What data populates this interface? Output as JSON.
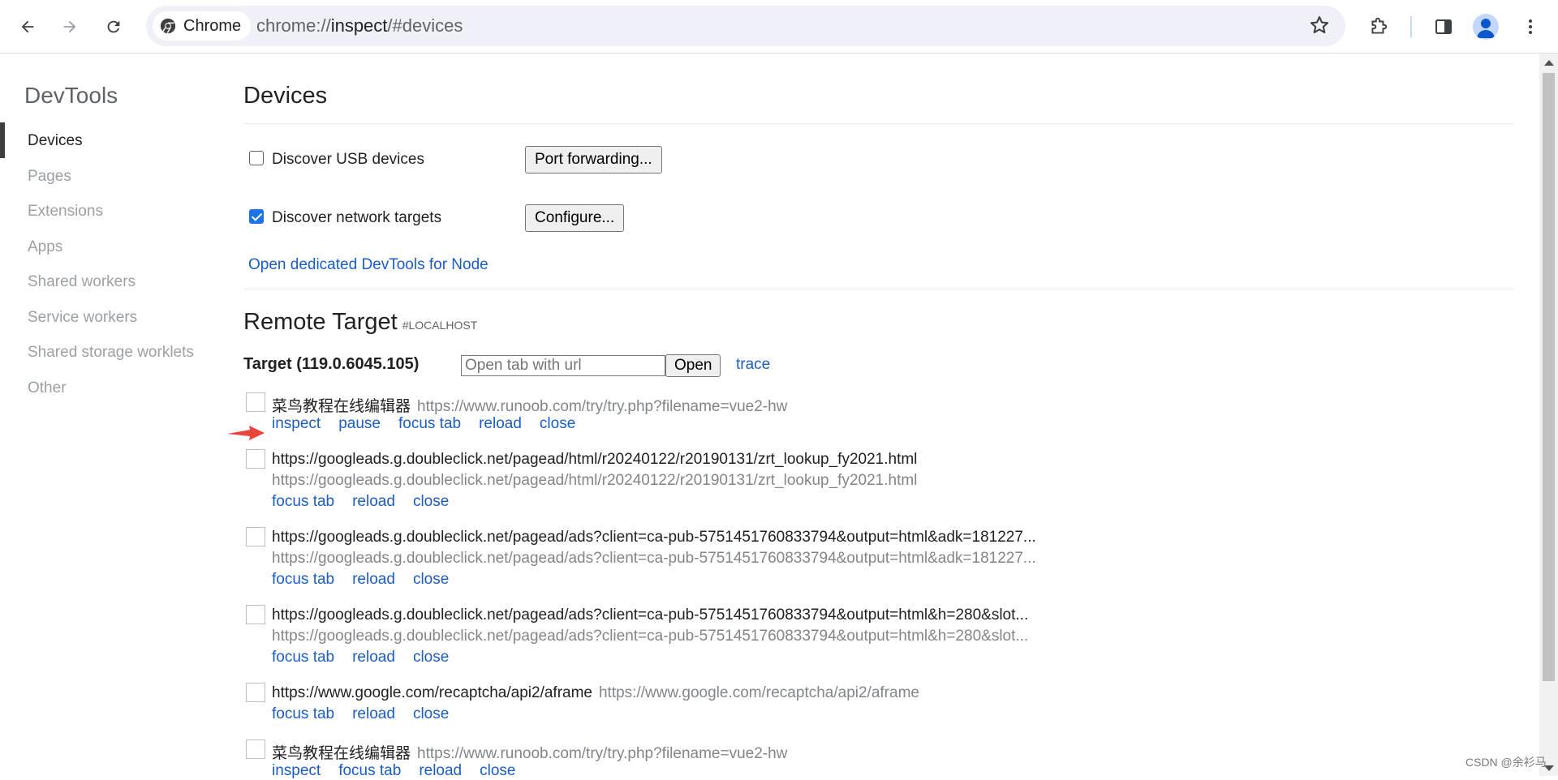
{
  "browser": {
    "chip_label": "Chrome",
    "url_scheme": "chrome://",
    "url_host": "inspect",
    "url_path": "/#devices"
  },
  "sidebar": {
    "title": "DevTools",
    "items": [
      {
        "label": "Devices",
        "active": true
      },
      {
        "label": "Pages"
      },
      {
        "label": "Extensions"
      },
      {
        "label": "Apps"
      },
      {
        "label": "Shared workers"
      },
      {
        "label": "Service workers"
      },
      {
        "label": "Shared storage worklets"
      },
      {
        "label": "Other"
      }
    ]
  },
  "devices": {
    "title": "Devices",
    "usb_label": "Discover USB devices",
    "usb_checked": false,
    "port_forwarding_label": "Port forwarding...",
    "network_label": "Discover network targets",
    "network_checked": true,
    "configure_label": "Configure...",
    "node_link": "Open dedicated DevTools for Node"
  },
  "remote": {
    "title": "Remote Target",
    "hint": "#LOCALHOST",
    "target_label": "Target (119.0.6045.105)",
    "url_placeholder": "Open tab with url",
    "open_label": "Open",
    "trace_label": "trace"
  },
  "pages": [
    {
      "title": "菜鸟教程在线编辑器",
      "url": "https://www.runoob.com/try/try.php?filename=vue2-hw",
      "actions": [
        "inspect",
        "pause",
        "focus tab",
        "reload",
        "close"
      ]
    },
    {
      "title": "https://googleads.g.doubleclick.net/pagead/html/r20240122/r20190131/zrt_lookup_fy2021.html",
      "sub": "https://googleads.g.doubleclick.net/pagead/html/r20240122/r20190131/zrt_lookup_fy2021.html",
      "actions": [
        "focus tab",
        "reload",
        "close"
      ]
    },
    {
      "title": "https://googleads.g.doubleclick.net/pagead/ads?client=ca-pub-5751451760833794&output=html&adk=181227...",
      "sub": "https://googleads.g.doubleclick.net/pagead/ads?client=ca-pub-5751451760833794&output=html&adk=181227...",
      "actions": [
        "focus tab",
        "reload",
        "close"
      ]
    },
    {
      "title": "https://googleads.g.doubleclick.net/pagead/ads?client=ca-pub-5751451760833794&output=html&h=280&slot...",
      "sub": "https://googleads.g.doubleclick.net/pagead/ads?client=ca-pub-5751451760833794&output=html&h=280&slot...",
      "actions": [
        "focus tab",
        "reload",
        "close"
      ]
    },
    {
      "title": "https://www.google.com/recaptcha/api2/aframe",
      "url": "https://www.google.com/recaptcha/api2/aframe",
      "actions": [
        "focus tab",
        "reload",
        "close"
      ]
    },
    {
      "title": "菜鸟教程在线编辑器",
      "url": "https://www.runoob.com/try/try.php?filename=vue2-hw",
      "actions": [
        "inspect",
        "focus tab",
        "reload",
        "close"
      ]
    }
  ],
  "watermark": "CSDN @余衫马",
  "colors": {
    "link": "#1a5dc7",
    "annotation_arrow": "#e8453c",
    "accent": "#1a73e8"
  }
}
